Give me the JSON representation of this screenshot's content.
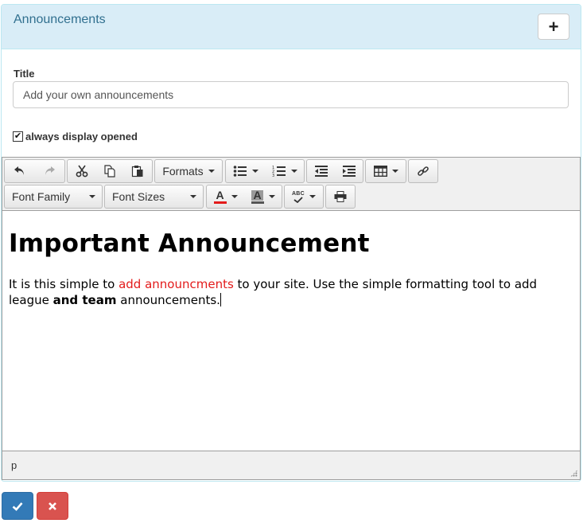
{
  "panel": {
    "title": "Announcements",
    "add_button_icon": "plus-icon"
  },
  "form": {
    "title_label": "Title",
    "title_value": "Add your own announcements",
    "checkbox_label": "always display opened",
    "checkbox_checked": true
  },
  "toolbar": {
    "row1": [
      "undo-icon",
      "redo-icon",
      "cut-icon",
      "copy-icon",
      "paste-icon",
      "Formats",
      "bullet-list-icon",
      "numbered-list-icon",
      "outdent-icon",
      "indent-icon",
      "table-icon",
      "link-icon"
    ],
    "formats_label": "Formats",
    "font_family_label": "Font Family",
    "font_sizes_label": "Font Sizes",
    "text_color_glyph": "A",
    "bg_color_glyph": "A",
    "spellcheck_glyph": "ABC",
    "text_color": "#e31b1b"
  },
  "content": {
    "heading": "Important Announcement",
    "p_part1": "It is this simple to ",
    "p_red": "add announcments",
    "p_part2": " to your site. Use the simple formatting tool to add league ",
    "p_bold": "and team",
    "p_part3": " announcements."
  },
  "statusbar": {
    "path": "p"
  },
  "colors": {
    "heading_bg": "#d9edf7",
    "heading_text": "#31708f",
    "save": "#337ab7",
    "cancel": "#d9534f",
    "highlight_red": "#e31b1b"
  }
}
